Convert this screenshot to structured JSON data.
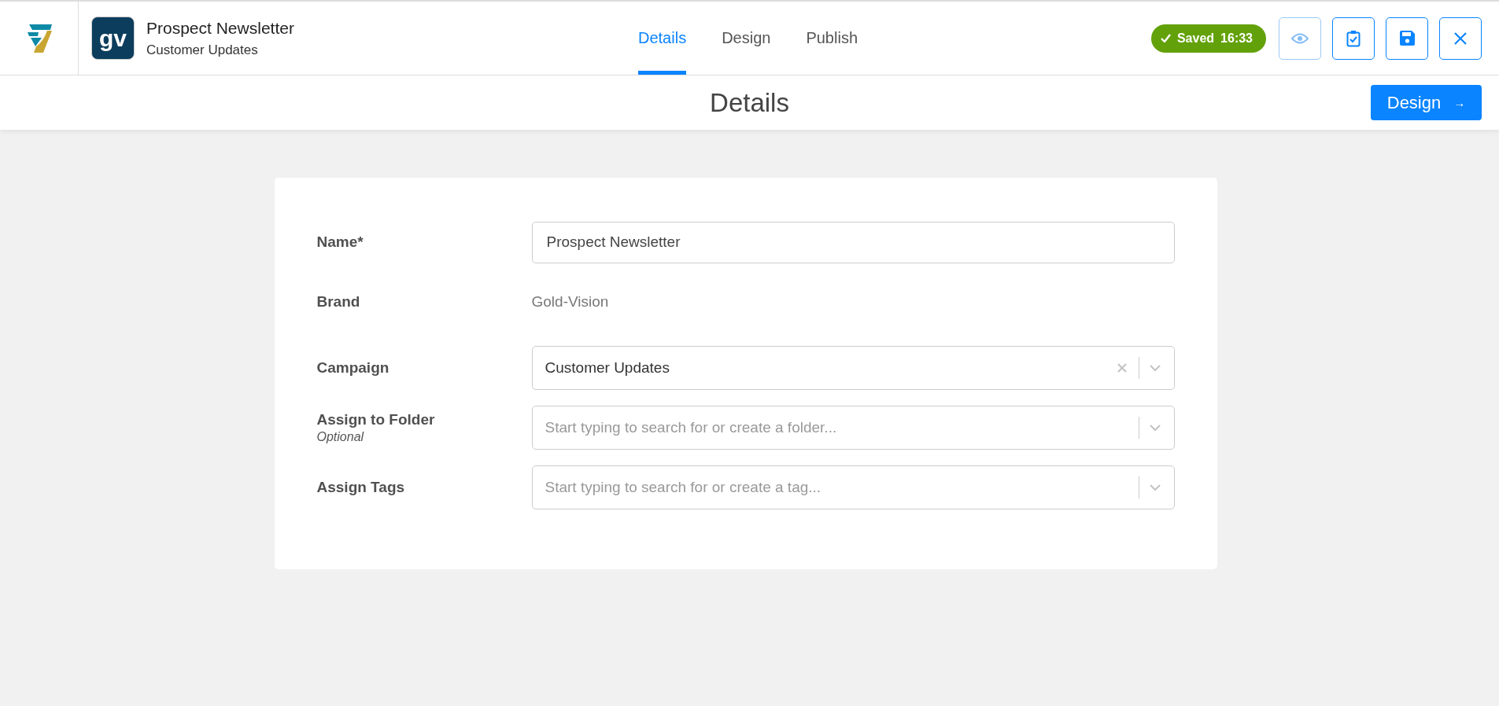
{
  "header": {
    "item_title": "Prospect Newsletter",
    "item_subtitle": "Customer Updates",
    "brand_badge": "gv",
    "tabs": [
      {
        "label": "Details",
        "selected": true
      },
      {
        "label": "Design",
        "selected": false
      },
      {
        "label": "Publish",
        "selected": false
      }
    ],
    "status": {
      "label": "Saved",
      "time": "16:33"
    },
    "actions": [
      {
        "kind": "preview",
        "disabled": true
      },
      {
        "kind": "checklist",
        "disabled": false
      },
      {
        "kind": "save",
        "disabled": false
      },
      {
        "kind": "close",
        "disabled": false
      }
    ]
  },
  "page_title": "Details",
  "next_button": {
    "label": "Design",
    "arrow": "→"
  },
  "fields": [
    {
      "kind": "text",
      "label": "Name*",
      "value": "Prospect Newsletter"
    },
    {
      "kind": "static",
      "label": "Brand",
      "value": "Gold-Vision"
    },
    {
      "kind": "select",
      "label": "Campaign",
      "value": "Customer Updates",
      "clearable": true
    },
    {
      "kind": "select",
      "label": "Assign to Folder",
      "hint": "Optional",
      "placeholder": "Start typing to search for or create a folder...",
      "clearable": false
    },
    {
      "kind": "select",
      "label": "Assign Tags",
      "placeholder": "Start typing to search for or create a tag...",
      "clearable": false
    }
  ]
}
